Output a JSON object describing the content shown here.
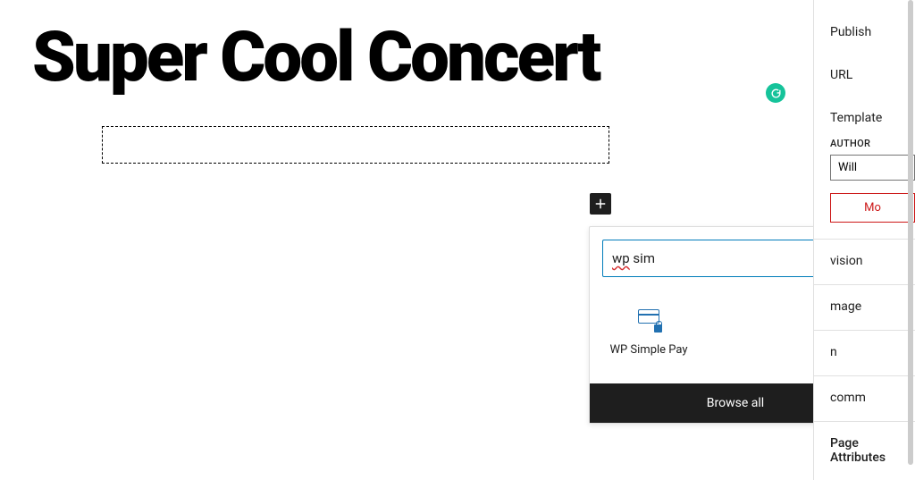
{
  "editor": {
    "post_title": "Super Cool Concert"
  },
  "inserter": {
    "search_value": "wp sim",
    "search_wp": "wp",
    "search_rest": " sim",
    "results": [
      {
        "label": "WP Simple Pay"
      }
    ],
    "browse_all_label": "Browse all"
  },
  "sidebar": {
    "publish": {
      "label": "Publish"
    },
    "url": {
      "label": "URL"
    },
    "template": {
      "label": "Template"
    },
    "author": {
      "heading": "AUTHOR",
      "value": "Will"
    },
    "move_trash": "Mo",
    "revisions": "vision",
    "featured_image": "mage",
    "excerpt": "n",
    "discussion": "comm",
    "page_attributes": "Page Attributes"
  }
}
